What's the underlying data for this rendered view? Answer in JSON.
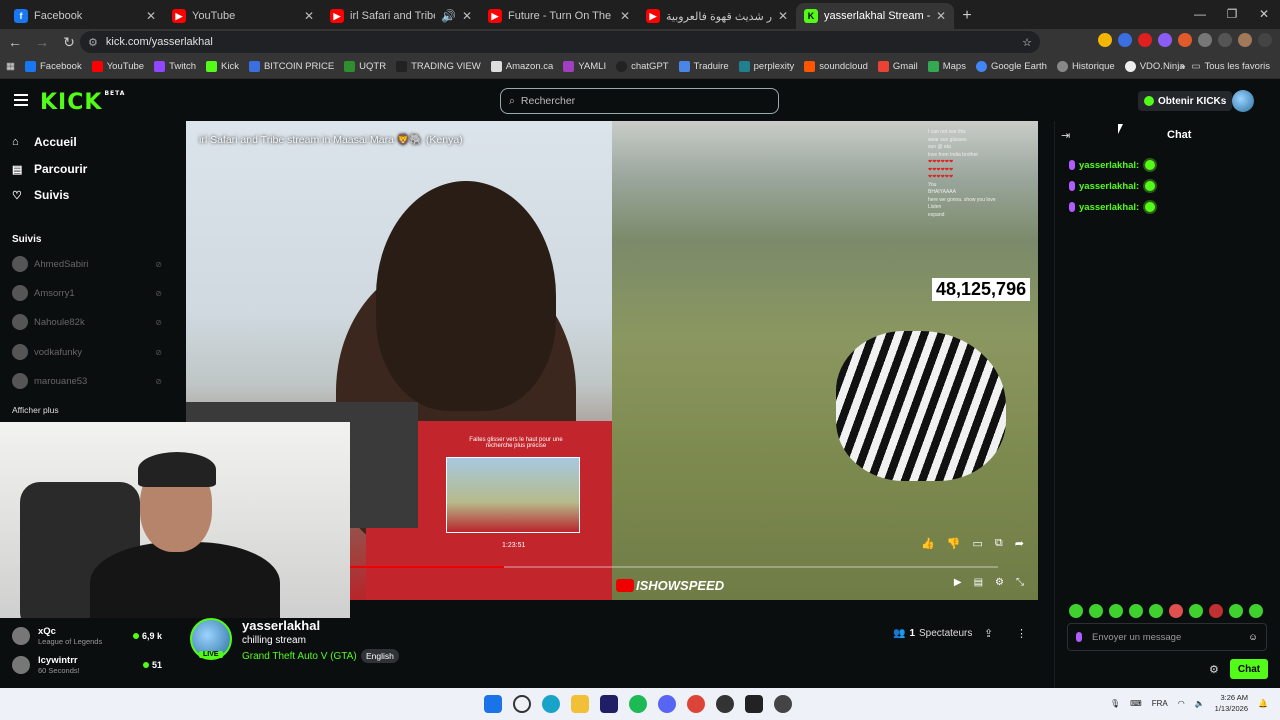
{
  "browser": {
    "tabs": [
      {
        "label": "Facebook",
        "icon": "facebook-icon",
        "color": "#1877f2",
        "glyph": "f"
      },
      {
        "label": "YouTube",
        "icon": "youtube-icon",
        "color": "#ff0000",
        "glyph": "▶"
      },
      {
        "label": "irl Safari and Tribe stream i",
        "icon": "youtube-icon",
        "color": "#ff0000",
        "glyph": "▶"
      },
      {
        "label": "Future - Turn On The Lights (Of",
        "icon": "youtube-icon",
        "color": "#ff0000",
        "glyph": "▶"
      },
      {
        "label": "نهار شديث قهوة فالعروبية \"",
        "icon": "youtube-icon",
        "color": "#ff0000",
        "glyph": "▶"
      },
      {
        "label": "yasserlakhal Stream - Watch Li",
        "icon": "kick-icon",
        "color": "#53fc18",
        "glyph": "K"
      }
    ],
    "url": "kick.com/yasserlakhal",
    "bookmarks": [
      "Facebook",
      "YouTube",
      "Twitch",
      "Kick",
      "BITCOIN PRICE",
      "UQTR",
      "TRADING VIEW",
      "Amazon.ca",
      "YAMLI",
      "chatGPT",
      "Traduire",
      "perplexity",
      "soundcloud",
      "Gmail",
      "Maps",
      "Google Earth",
      "Historique",
      "VDO.Ninja"
    ],
    "all_bookmarks": "Tous les favoris"
  },
  "kick": {
    "logo": "KICK",
    "beta": "BETA",
    "search_placeholder": "Rechercher",
    "get_kicks": "Obtenir KICKs",
    "nav": [
      "Accueil",
      "Parcourir",
      "Suivis"
    ],
    "following_header": "Suivis",
    "following": [
      "AhmedSabiri",
      "Amsorry1",
      "Nahoule82k",
      "vodkafunky",
      "marouane53"
    ],
    "show_more": "Afficher plus"
  },
  "video": {
    "title": "irl Safari and Tribe stream in Maasai Mara 🦁🐘 (Kenya)",
    "view_count": "48,125,796",
    "swipe_hint": "Faites glisser vers le haut pour une recherche plus précise",
    "thumb_time": "1:23:51",
    "watermark": "ISHOWSPEED",
    "progress": 0.24,
    "overlay_chat": [
      "I can not see this",
      "wear sun glasses",
      "sun @ ata",
      "love from India brother",
      "❤❤❤❤❤❤",
      "❤❤❤❤❤❤",
      "❤❤❤❤❤❤",
      "You",
      "BHAIYAAAA",
      "here we gonna. show you love",
      "Listen",
      "expand"
    ]
  },
  "recommended": [
    {
      "name": "xQc",
      "game": "League of Legends",
      "count": "6,9 k"
    },
    {
      "name": "lcywintrr",
      "game": "60 Seconds!",
      "count": "51"
    }
  ],
  "stream_info": {
    "name": "yasserlakhal",
    "subtitle": "chilling stream",
    "category": "Grand Theft Auto V (GTA)",
    "language": "English",
    "live": "LIVE",
    "viewers_count": "1",
    "viewers_label": "Spectateurs"
  },
  "chat": {
    "title": "Chat",
    "messages": [
      "yasserlakhal:",
      "yasserlakhal:",
      "yasserlakhal:"
    ],
    "input_placeholder": "Envoyer un message",
    "send_button": "Chat"
  },
  "taskbar": {
    "lang": "FRA",
    "time": "3:26 AM",
    "date": "1/13/2026"
  },
  "colors": {
    "kick_green": "#53fc18",
    "bg": "#0b0e0f"
  }
}
